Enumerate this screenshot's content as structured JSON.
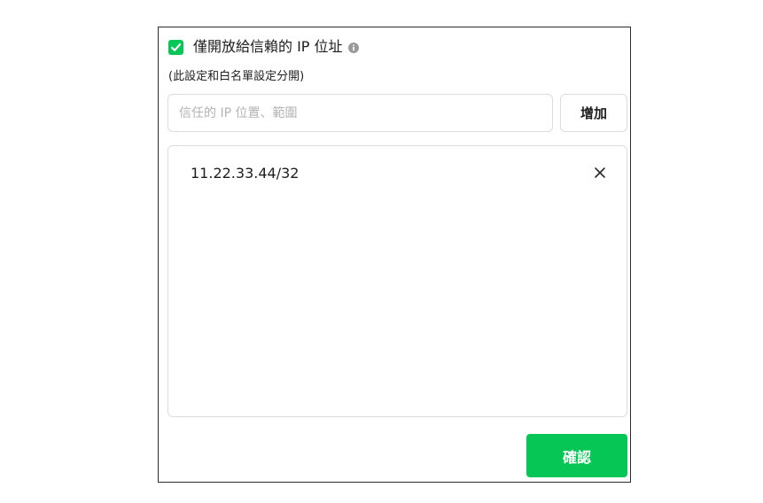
{
  "trusted_ip": {
    "checkbox_label": "僅開放給信賴的 IP 位址",
    "checked": true,
    "note": "(此設定和白名單設定分開)",
    "input_placeholder": "信任的 IP 位置、範圍",
    "input_value": "",
    "add_label": "增加",
    "items": [
      {
        "ip": "11.22.33.44/32"
      }
    ],
    "confirm_label": "確認"
  },
  "icons": {
    "checkbox": "check-icon",
    "info": "info-icon",
    "remove": "close-icon"
  },
  "colors": {
    "accent": "#06c755",
    "border": "#dcdcdc",
    "text": "#1e1e1e",
    "placeholder": "#b3b3b3"
  }
}
